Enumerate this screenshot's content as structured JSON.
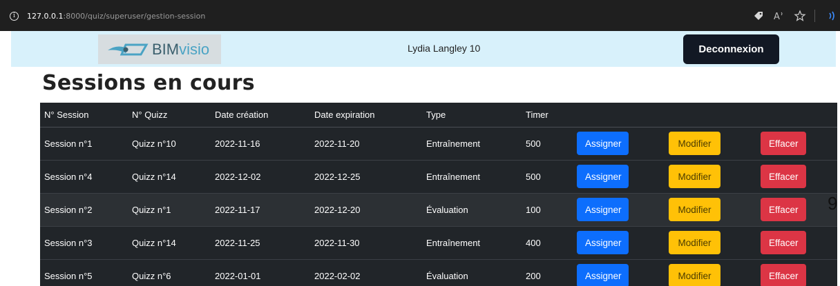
{
  "browser": {
    "url_host": "127.0.0.1",
    "url_rest": ":8000/quiz/superuser/gestion-session",
    "icons": [
      "info-icon",
      "tag-icon",
      "read-aloud-icon",
      "favorite-star-icon",
      "extension-icon"
    ]
  },
  "header": {
    "logo_text_bim": "BIM",
    "logo_text_visio": "visio",
    "user_name": "Lydia Langley 10",
    "logout_label": "Deconnexion"
  },
  "page": {
    "title": "Sessions en cours",
    "stray_text": "9"
  },
  "table": {
    "headers": [
      "N° Session",
      "N° Quizz",
      "Date création",
      "Date expiration",
      "Type",
      "Timer",
      "",
      "",
      ""
    ],
    "button_labels": {
      "assign": "Assigner",
      "edit": "Modifier",
      "delete": "Effacer"
    },
    "rows": [
      {
        "session": "Session n°1",
        "quiz": "Quizz n°10",
        "created": "2022-11-16",
        "expires": "2022-11-20",
        "type": "Entraînement",
        "timer": "500"
      },
      {
        "session": "Session n°4",
        "quiz": "Quizz n°14",
        "created": "2022-12-02",
        "expires": "2022-12-25",
        "type": "Entraînement",
        "timer": "500"
      },
      {
        "session": "Session n°2",
        "quiz": "Quizz n°1",
        "created": "2022-11-17",
        "expires": "2022-12-20",
        "type": "Évaluation",
        "timer": "100"
      },
      {
        "session": "Session n°3",
        "quiz": "Quizz n°14",
        "created": "2022-11-25",
        "expires": "2022-11-30",
        "type": "Entraînement",
        "timer": "400"
      },
      {
        "session": "Session n°5",
        "quiz": "Quizz n°6",
        "created": "2022-01-01",
        "expires": "2022-02-02",
        "type": "Évaluation",
        "timer": "200"
      }
    ]
  },
  "colors": {
    "header_bg": "#d8f1fb",
    "table_bg": "#212529",
    "assign": "#0d6efd",
    "edit": "#ffc107",
    "delete": "#dc3545",
    "logout_bg": "#121824"
  }
}
